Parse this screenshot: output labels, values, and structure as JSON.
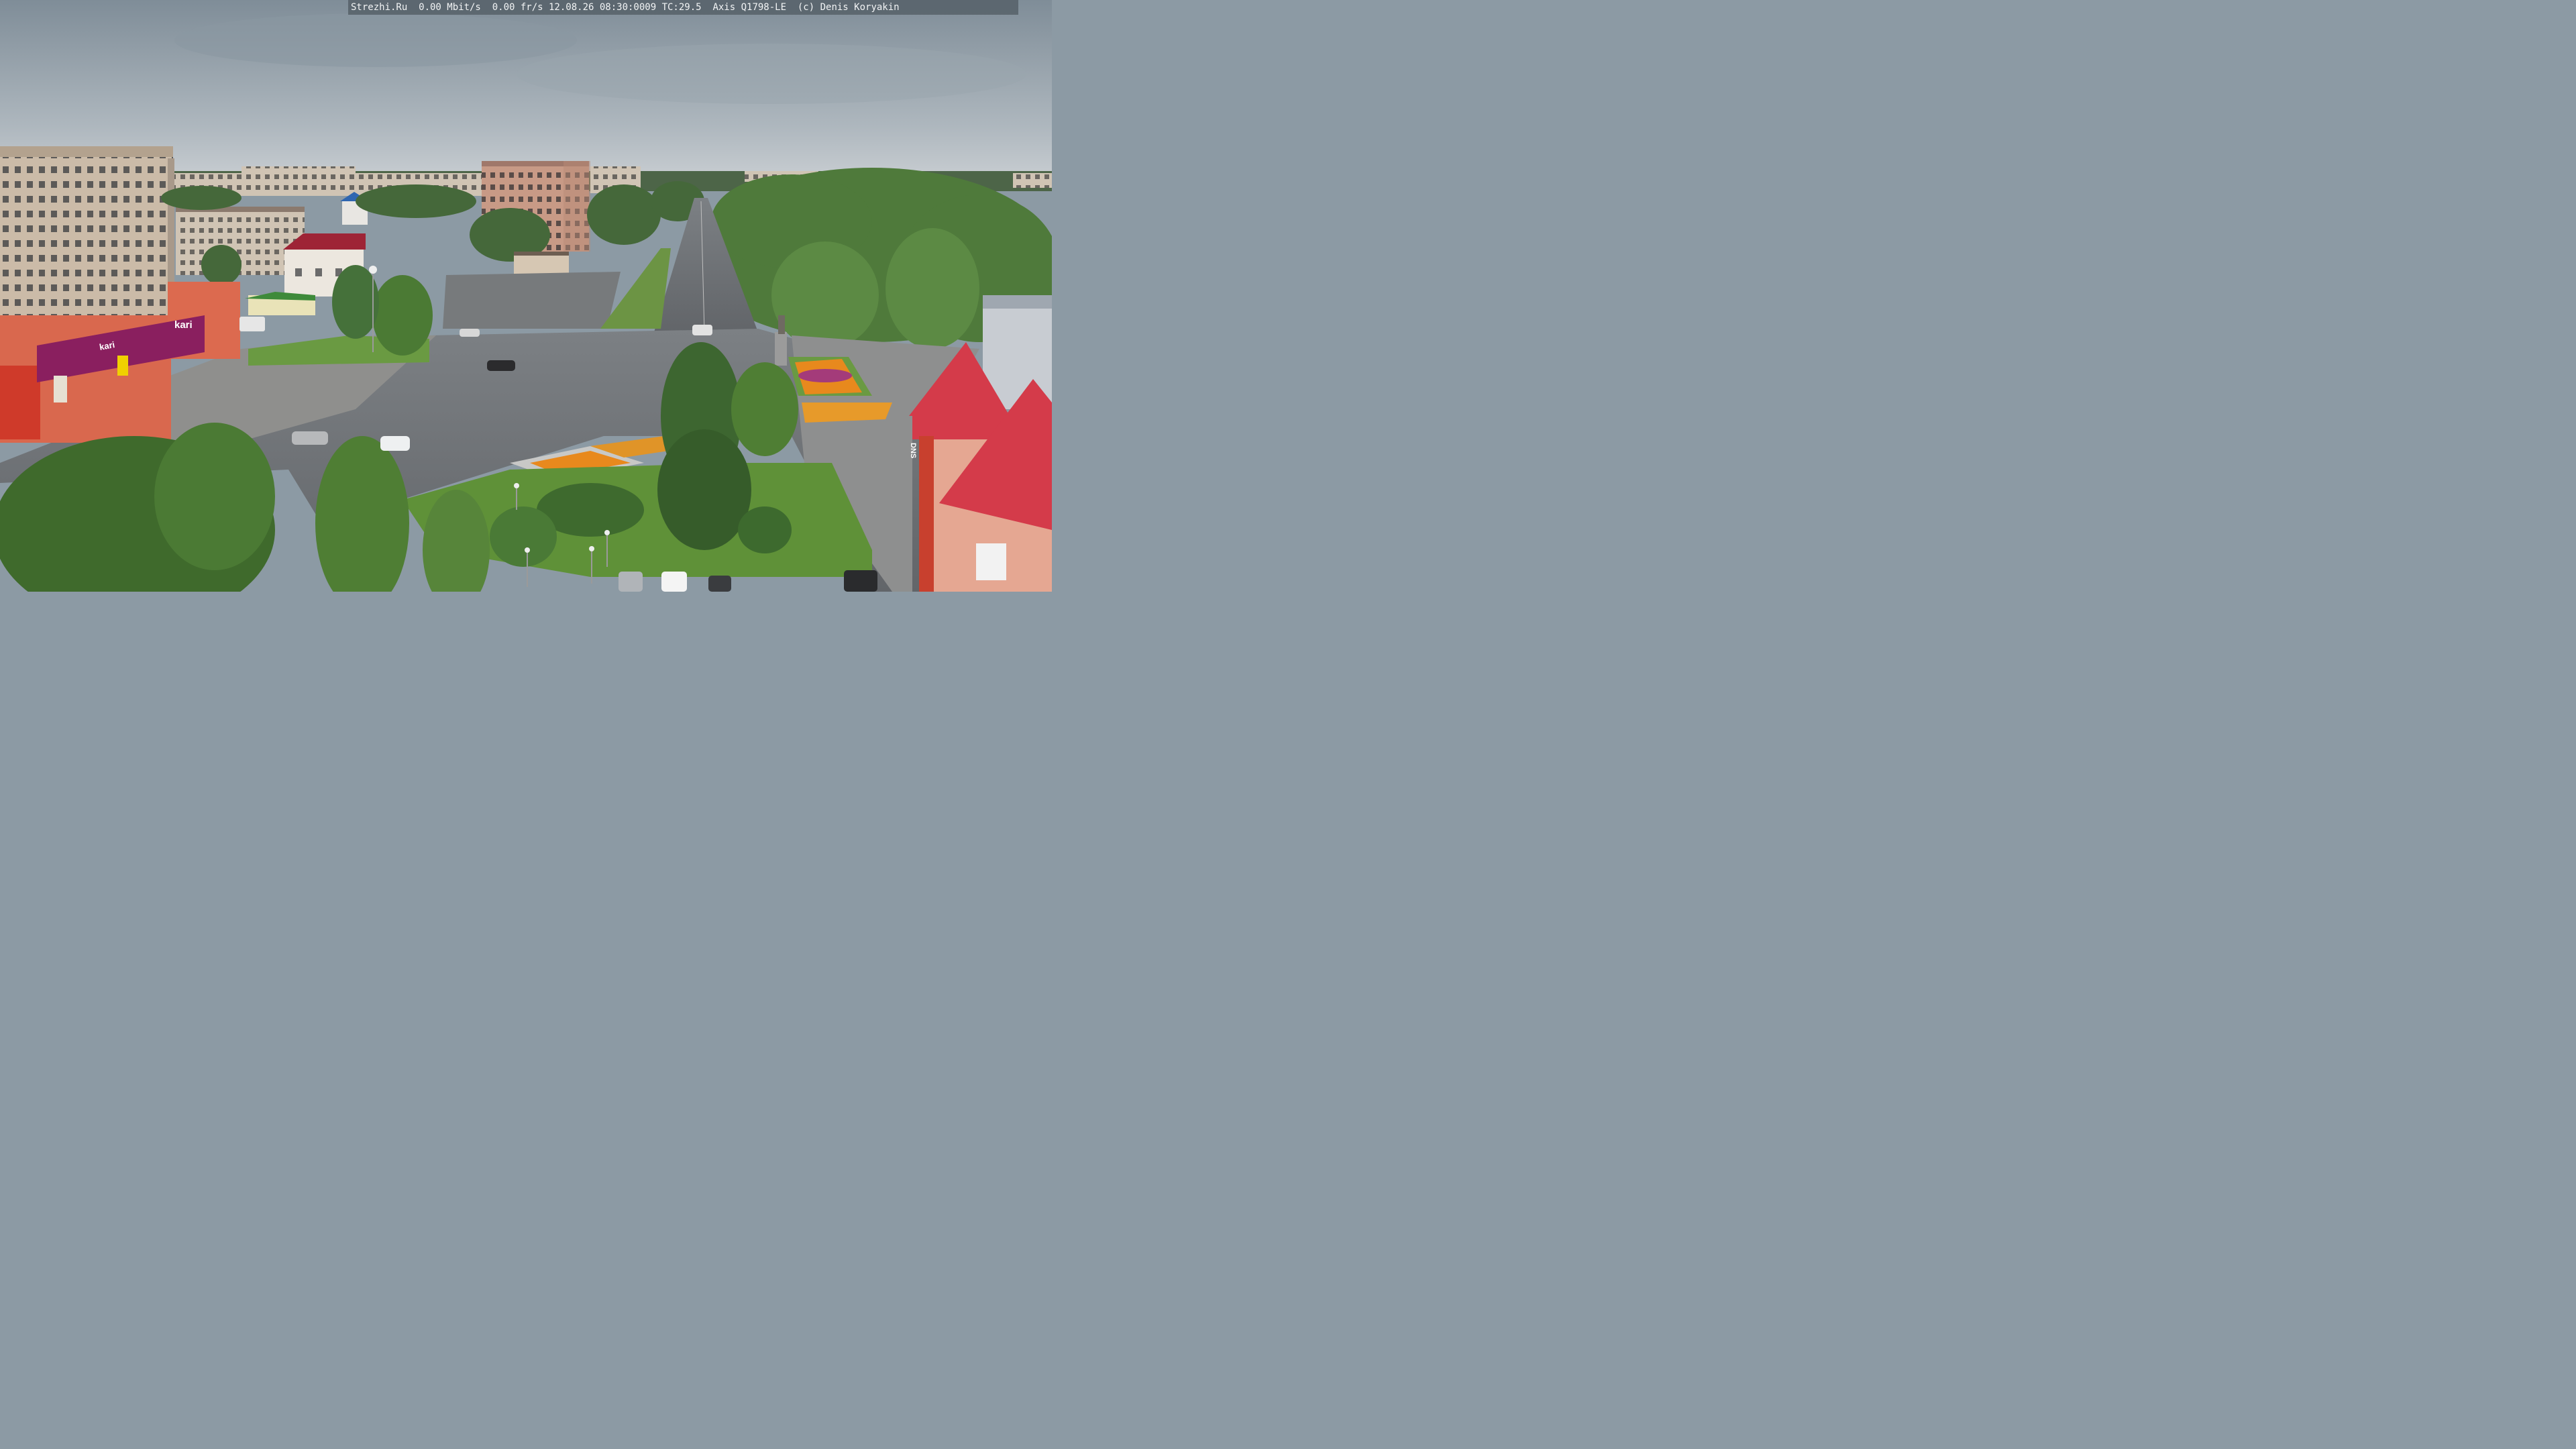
{
  "overlay": {
    "text": "Strezhi.Ru  0.00 Mbit/s  0.00 fr/s 12.08.26 08:30:0009 TC:29.5  Axis Q1798-LE  (c) Denis Koryakin"
  },
  "signs": {
    "kari_logo": "kari",
    "kari_banner": "kari",
    "dns_logo": "DNS"
  },
  "colors": {
    "sky_top": "#7d8b96",
    "sky_bottom": "#c6ccd1",
    "kari_purple": "#8a1f5f",
    "roof_red": "#d43b4a",
    "road": "#6a6e72",
    "grass": "#5f8c3a",
    "flowers": "#e8891d"
  }
}
